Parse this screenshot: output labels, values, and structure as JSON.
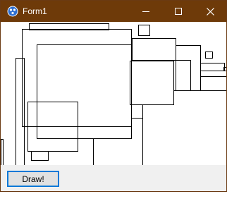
{
  "window": {
    "title": "Form1",
    "icon": "app-icon",
    "titlebar_color": "#6e3a09",
    "controls": [
      {
        "name": "minimize-icon",
        "glyph": "minimize"
      },
      {
        "name": "maximize-icon",
        "glyph": "maximize"
      },
      {
        "name": "close-icon",
        "glyph": "close"
      }
    ]
  },
  "toolbar": {
    "draw_label": "Draw!"
  },
  "accent_color": "#0078d7"
}
